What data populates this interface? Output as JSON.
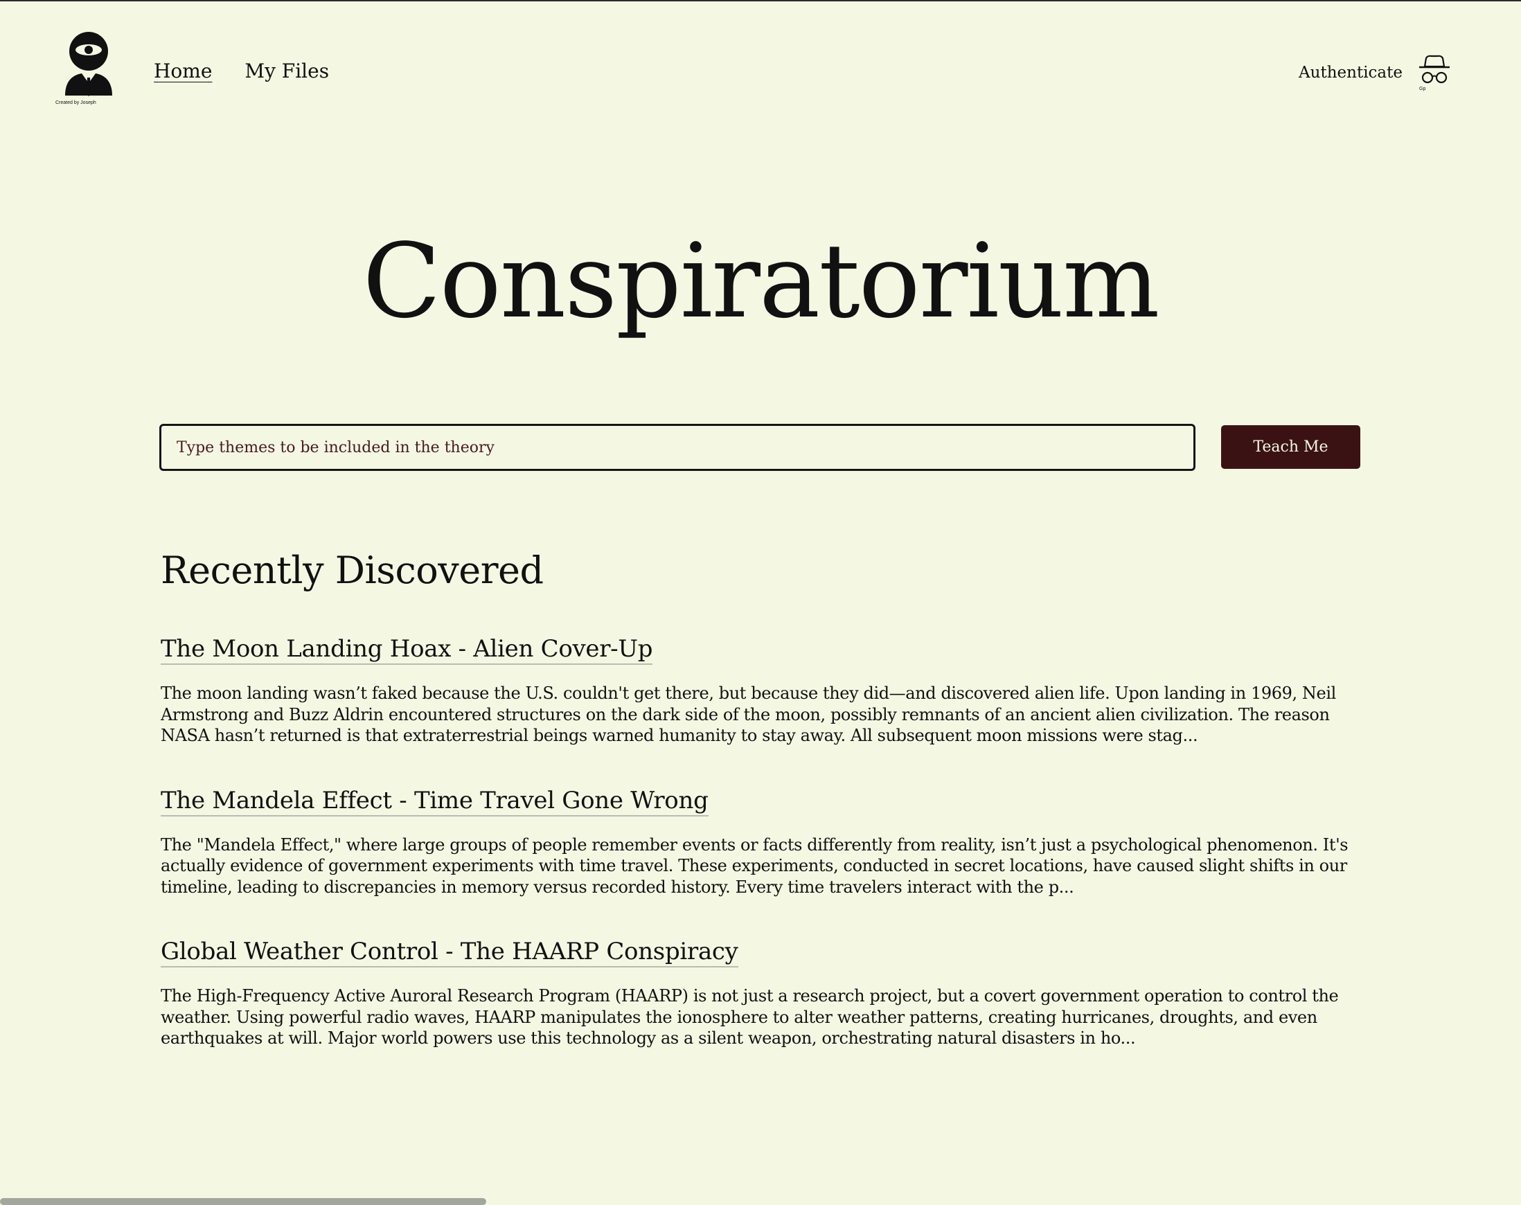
{
  "header": {
    "logo_caption": "Created by Joseph",
    "nav": [
      {
        "label": "Home"
      },
      {
        "label": "My Files"
      }
    ],
    "auth_label": "Authenticate",
    "incognito_tag": "Gp"
  },
  "hero": {
    "title": "Conspiratorium"
  },
  "search": {
    "placeholder": "Type themes to be included in the theory",
    "value": "",
    "button_label": "Teach Me"
  },
  "recent": {
    "heading": "Recently Discovered",
    "items": [
      {
        "title": "The Moon Landing Hoax - Alien Cover-Up",
        "body": "The moon landing wasn’t faked because the U.S. couldn't get there, but because they did—and discovered alien life. Upon landing in 1969, Neil Armstrong and Buzz Aldrin encountered structures on the dark side of the moon, possibly remnants of an ancient alien civilization. The reason NASA hasn’t returned is that extraterrestrial beings warned humanity to stay away. All subsequent moon missions were stag..."
      },
      {
        "title": "The Mandela Effect - Time Travel Gone Wrong",
        "body": "The \"Mandela Effect,\" where large groups of people remember events or facts differently from reality, isn’t just a psychological phenomenon. It's actually evidence of government experiments with time travel. These experiments, conducted in secret locations, have caused slight shifts in our timeline, leading to discrepancies in memory versus recorded history. Every time travelers interact with the p..."
      },
      {
        "title": "Global Weather Control - The HAARP Conspiracy",
        "body": "The High-Frequency Active Auroral Research Program (HAARP) is not just a research project, but a covert government operation to control the weather. Using powerful radio waves, HAARP manipulates the ionosphere to alter weather patterns, creating hurricanes, droughts, and even earthquakes at will. Major world powers use this technology as a silent weapon, orchestrating natural disasters in ho..."
      }
    ]
  },
  "colors": {
    "background": "#f4f8e3",
    "accent": "#3b1214",
    "text": "#111111"
  },
  "icons": {
    "logo": "eye-agent-icon",
    "auth": "incognito-hat-glasses-icon"
  }
}
